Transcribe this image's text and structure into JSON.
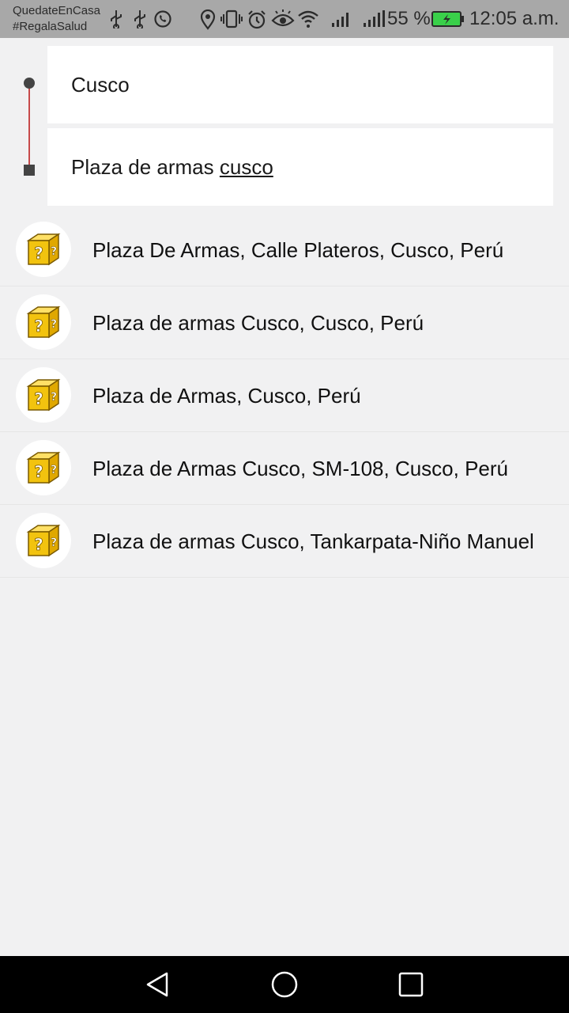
{
  "status_bar": {
    "carrier_line1": "QuedateEnCasa",
    "carrier_line2": "#RegalaSalud",
    "battery_percent": "55 %",
    "time": "12:05 a.m.",
    "icons": [
      "usb-icon",
      "usb-icon",
      "whatsapp-icon",
      "location-icon",
      "vibrate-icon",
      "alarm-icon",
      "eye-icon",
      "wifi-icon",
      "signal-icon",
      "signal-icon",
      "battery-icon"
    ]
  },
  "route": {
    "origin_value": "Cusco",
    "destination_prefix": "Plaza de armas ",
    "destination_typed": "cusco"
  },
  "suggestions": [
    {
      "label": "Plaza De Armas, Calle Plateros, Cusco, Perú",
      "icon": "question-block-icon"
    },
    {
      "label": "Plaza de armas Cusco, Cusco, Perú",
      "icon": "question-block-icon"
    },
    {
      "label": "Plaza de Armas, Cusco, Perú",
      "icon": "question-block-icon"
    },
    {
      "label": "Plaza de Armas Cusco, SM-108, Cusco, Perú",
      "icon": "question-block-icon"
    },
    {
      "label": "Plaza de armas Cusco, Tankarpata-Niño Manuel",
      "icon": "question-block-icon"
    }
  ],
  "nav_bar": {
    "icons": [
      "back-icon",
      "home-icon",
      "recents-icon"
    ]
  },
  "colors": {
    "status_bar_bg": "#a8a8a8",
    "route_line": "#c74a4a",
    "background": "#f1f1f2",
    "block_yellow": "#f2c30f"
  }
}
